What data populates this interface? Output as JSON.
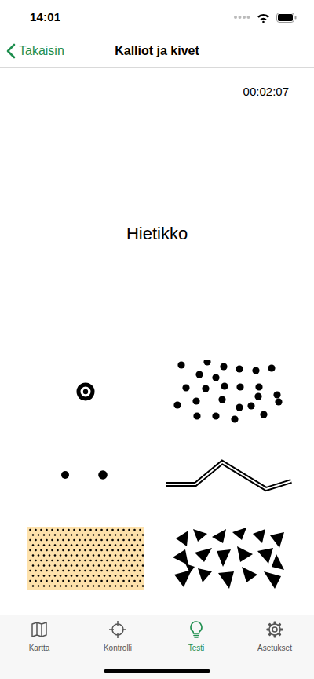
{
  "status_bar": {
    "time": "14:01"
  },
  "nav": {
    "back": "Takaisin",
    "title": "Kalliot ja kivet"
  },
  "timer": "00:02:07",
  "question": "Hietikko",
  "options": [
    {
      "kind": "ring"
    },
    {
      "kind": "scatter"
    },
    {
      "kind": "pair"
    },
    {
      "kind": "zigzag"
    },
    {
      "kind": "sand"
    },
    {
      "kind": "boulderfield"
    }
  ],
  "tabs": [
    {
      "label": "Kartta",
      "selected": false
    },
    {
      "label": "Kontrolli",
      "selected": false
    },
    {
      "label": "Testi",
      "selected": true
    },
    {
      "label": "Asetukset",
      "selected": false
    }
  ]
}
